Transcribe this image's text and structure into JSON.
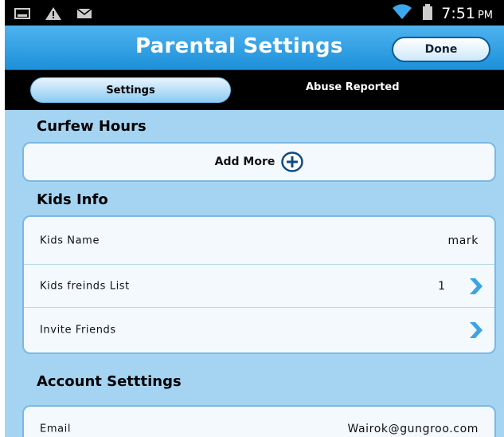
{
  "status_bar": {
    "icons": [
      "screenshot-icon",
      "warning-icon",
      "message-icon",
      "wifi-icon",
      "battery-icon"
    ],
    "time": "7:51",
    "ampm": "PM"
  },
  "header": {
    "title": "Parental Settings",
    "done_label": "Done"
  },
  "tabs": [
    {
      "label": "Settings",
      "selected": true
    },
    {
      "label": "Abuse Reported",
      "selected": false
    }
  ],
  "sections": {
    "curfew": {
      "title": "Curfew Hours",
      "add_more_label": "Add More"
    },
    "kids_info": {
      "title": "Kids Info",
      "rows": [
        {
          "label": "Kids Name",
          "value": "mark"
        },
        {
          "label": "Kids freinds List",
          "count": "1"
        },
        {
          "label": "Invite Friends"
        }
      ]
    },
    "account": {
      "title": "Account Setttings",
      "rows": [
        {
          "label": "Email",
          "value": "Wairok@gungroo.com"
        }
      ]
    }
  },
  "colors": {
    "accent": "#1d90d9",
    "background": "#a5d4f2",
    "chevron": "#3da3e5"
  }
}
